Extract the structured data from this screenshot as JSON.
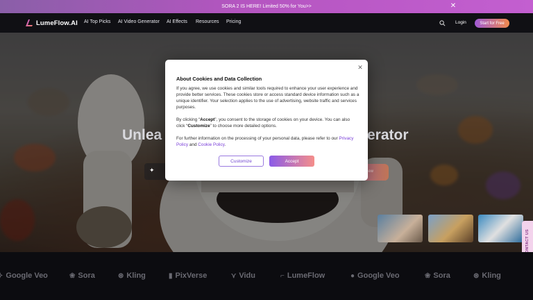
{
  "promo": {
    "text": "SORA 2 IS HERE! Limited 50% for You>>"
  },
  "nav": {
    "brand": "LumeFlow.AI",
    "links": [
      "AI Top Picks",
      "AI Video Generator",
      "AI Effects",
      "Resources",
      "Pricing"
    ],
    "login": "Login",
    "start": "Start for Free"
  },
  "hero": {
    "title_left": "Unlea",
    "title_right": "erator",
    "button_text": "iew"
  },
  "contact": {
    "label": "CONTACT US"
  },
  "models": [
    "Google Veo",
    "Sora",
    "Kling",
    "PixVerse",
    "Vidu",
    "LumeFlow",
    "Google Veo",
    "Sora",
    "Kling"
  ],
  "cookie": {
    "title": "About Cookies and Data Collection",
    "p1": "If you agree, we use cookies and similar tools required to enhance your user experience and provide better services. These cookies store or access standard device information such as a unique identifier. Your selection applies to the use of advertising, website traffic and services purposes.",
    "p2_a": "By clicking “",
    "p2_accept": "Accept",
    "p2_b": "”, you consent to the storage of cookies on your device. You can also click “",
    "p2_customize": "Customize",
    "p2_c": "” to choose more detailed options.",
    "p3_a": "For further information on the processing of your personal data, please refer to our ",
    "privacy_link": "Privacy Policy",
    "p3_b": " and ",
    "cookie_link": "Cookie Policy",
    "p3_c": ".",
    "customize": "Customize",
    "accept": "Accept"
  },
  "colors": {
    "accent": "#8b5be8",
    "promo": "#b455c0"
  }
}
